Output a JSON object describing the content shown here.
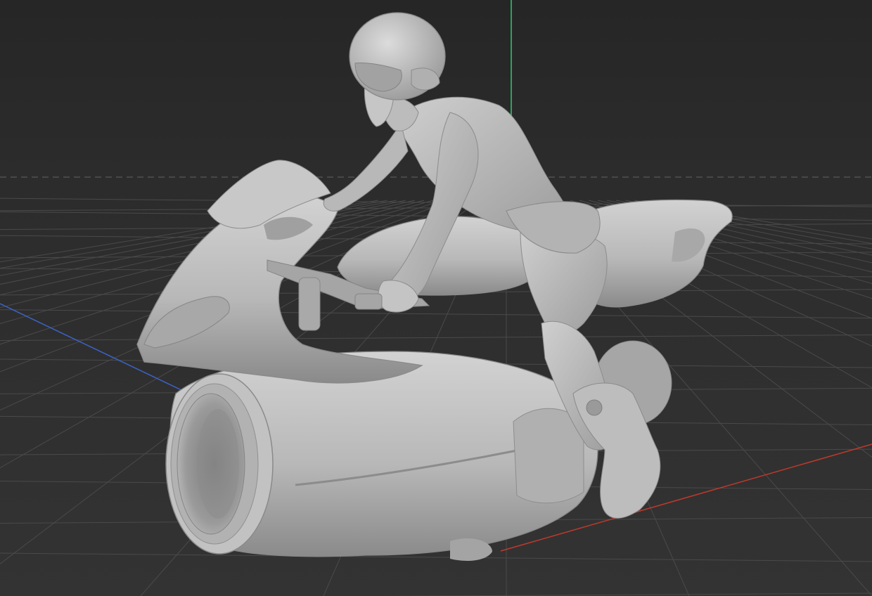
{
  "viewport": {
    "background_color": "#2b2b2b",
    "grid_color": "#4a4a4a",
    "horizon_color": "#5a5a5a",
    "axes": {
      "x_color": "#c0392b",
      "y_color": "#2ecc71",
      "z_color": "#3b64c8"
    },
    "model": {
      "material_color": "#b9b9b9",
      "shadow_color": "#8e8e8e",
      "highlight_color": "#d6d6d6"
    }
  }
}
